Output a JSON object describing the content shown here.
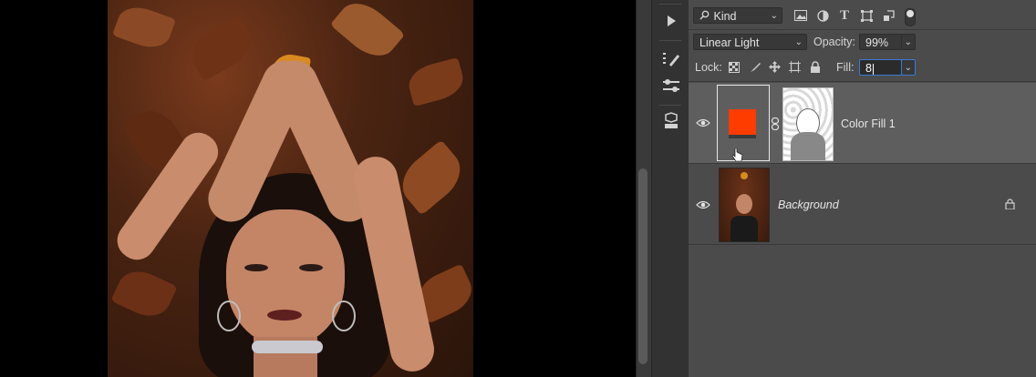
{
  "filter": {
    "kind_label": "Kind"
  },
  "blend": {
    "mode": "Linear Light",
    "opacity_label": "Opacity:",
    "opacity_value": "99%"
  },
  "lock": {
    "label": "Lock:",
    "fill_label": "Fill:",
    "fill_value": "8"
  },
  "layers": [
    {
      "name": "Color Fill 1",
      "swatch_color": "#fe3c00",
      "selected": true,
      "italic": false
    },
    {
      "name": "Background",
      "selected": false,
      "italic": true,
      "locked": true
    }
  ],
  "colors": {
    "panel_bg": "#4b4b4b",
    "selected_layer_bg": "#5e5e5e",
    "accent": "#3a7bd5"
  }
}
